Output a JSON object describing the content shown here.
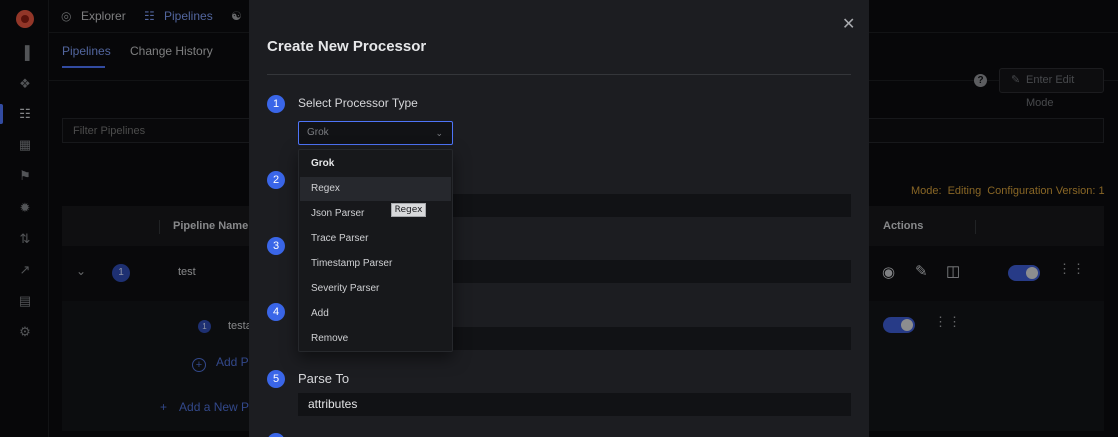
{
  "topnav": {
    "items": [
      {
        "label": "Explorer",
        "icon": "compass-icon"
      },
      {
        "label": "Pipelines",
        "icon": "pipelines-icon"
      },
      {
        "label": "",
        "icon": "alerts-icon"
      }
    ]
  },
  "tabs": {
    "pipelines": "Pipelines",
    "change_history": "Change History"
  },
  "toolbar": {
    "edit_mode_label": "Enter Edit Mode",
    "filter_placeholder": "Filter Pipelines"
  },
  "status": {
    "mode_label": "Mode:",
    "mode_value": "Editing",
    "version_label": "Configuration Version: 1"
  },
  "table": {
    "headers": {
      "pipeline_name": "Pipeline Name",
      "actions": "Actions"
    },
    "rows": [
      {
        "index": "1",
        "name": "test"
      }
    ],
    "subrows": [
      {
        "index": "1",
        "name": "testa"
      }
    ],
    "add_processor_label": "Add P",
    "add_pipeline_label": "Add a New P"
  },
  "modal": {
    "title": "Create New Processor",
    "steps": [
      {
        "number": "1",
        "label": "Select Processor Type"
      },
      {
        "number": "2",
        "label": ""
      },
      {
        "number": "3",
        "label": ""
      },
      {
        "number": "4",
        "label": ""
      },
      {
        "number": "5",
        "label": "Parse To"
      }
    ],
    "select_value": "Grok",
    "parse_to_value": "attributes",
    "options": [
      "Grok",
      "Regex",
      "Json Parser",
      "Trace Parser",
      "Timestamp Parser",
      "Severity Parser",
      "Add",
      "Remove"
    ],
    "selected_option": "Grok",
    "hovered_option": "Regex",
    "tooltip": "Regex"
  },
  "colors": {
    "accent": "#4e74f8",
    "status_warning": "#d19c3a",
    "modal_bg": "#1c1d21",
    "page_bg": "#0b0c0e"
  }
}
